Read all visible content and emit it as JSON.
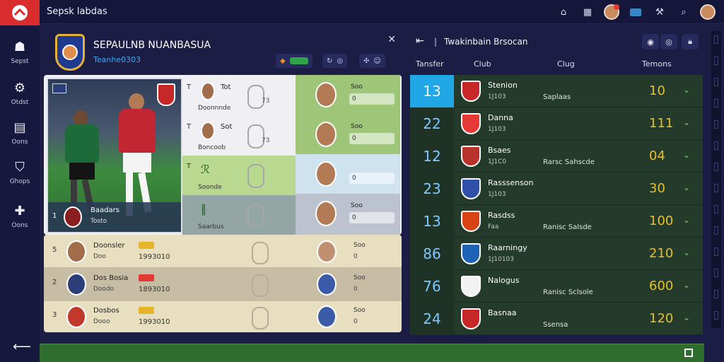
{
  "app": {
    "title": "Sepsk labdas"
  },
  "topbar": {
    "icons": [
      "home-icon",
      "calendar-icon",
      "notification-icon",
      "folder-icon",
      "tools-icon",
      "search-icon",
      "avatar"
    ]
  },
  "sidebar": {
    "items": [
      {
        "label": "Sepst",
        "icon": "club-icon"
      },
      {
        "label": "Otdst",
        "icon": "settings-icon"
      },
      {
        "label": "Oons",
        "icon": "document-icon"
      },
      {
        "label": "Ghops",
        "icon": "shield-icon"
      },
      {
        "label": "Oons",
        "icon": "add-icon"
      }
    ]
  },
  "club": {
    "name": "SEPAULNB NUANBASUA",
    "subtitle": "Teanhe0303"
  },
  "squad": {
    "hero": {
      "number": "1",
      "line1": "Baadars",
      "line2": "Tosto"
    },
    "rows": [
      {
        "pos": "T",
        "name": "Tot",
        "sub": "Doonnnde",
        "val": "73"
      },
      {
        "pos": "T",
        "name": "Sot",
        "sub": "Boncoob",
        "val": "73"
      },
      {
        "pos": "T",
        "name": "",
        "sub": "Soonde",
        "val": ""
      },
      {
        "pos": "",
        "name": "",
        "sub": "Saarbus",
        "val": ""
      }
    ],
    "cards": [
      {
        "label": "Soo",
        "value": "0"
      },
      {
        "label": "Soo",
        "value": "0"
      },
      {
        "label": "",
        "value": "0"
      },
      {
        "label": "Soo",
        "value": "0"
      }
    ],
    "bottom_rows": [
      {
        "idx": "5",
        "name": "Doonsler",
        "sub": "Doo",
        "num": "1993010",
        "tag_color": "#e6b52a",
        "lbl2": "Soo",
        "val2": "0"
      },
      {
        "idx": "2",
        "name": "Dos Bosia",
        "sub": "Doodo",
        "num": "1893010",
        "tag_color": "#e53935",
        "lbl2": "Soo",
        "val2": "0"
      },
      {
        "idx": "3",
        "name": "Dosbos",
        "sub": "Dooo",
        "num": "1993010",
        "tag_color": "#e6b52a",
        "lbl2": "Soo",
        "val2": "0"
      }
    ]
  },
  "transfers": {
    "title": "Twakinbain Brsocan",
    "columns": [
      "Tansfer",
      "Club",
      "Clug",
      "Temons"
    ],
    "rows": [
      {
        "rank": "13",
        "club": "Stenion",
        "sub": "1J103",
        "mid": "Saplaas",
        "score": "10",
        "shield": "#c62828"
      },
      {
        "rank": "22",
        "club": "Danna",
        "sub": "1J103",
        "mid": "",
        "score": "111",
        "shield": "#e53935"
      },
      {
        "rank": "12",
        "club": "Bsaes",
        "sub": "1J1C0",
        "mid": "Rarsc Sahscde",
        "score": "04",
        "shield": "#b7332b"
      },
      {
        "rank": "23",
        "club": "Rasssenson",
        "sub": "1J103",
        "mid": "",
        "score": "30",
        "shield": "#2f4fa8"
      },
      {
        "rank": "13",
        "club": "Rasdss",
        "sub": "Faa",
        "mid": "Ranisc Salsde",
        "score": "100",
        "shield": "#d84315"
      },
      {
        "rank": "86",
        "club": "Raarningy",
        "sub": "1J10103",
        "mid": "",
        "score": "210",
        "shield": "#1e63b6"
      },
      {
        "rank": "76",
        "club": "Nalogus",
        "sub": "",
        "mid": "Ranisc Sclsole",
        "score": "600",
        "shield": "#f2f2f2"
      },
      {
        "rank": "24",
        "club": "Basnaa",
        "sub": "",
        "mid": "Ssensa",
        "score": "120",
        "shield": "#c62828"
      }
    ]
  }
}
